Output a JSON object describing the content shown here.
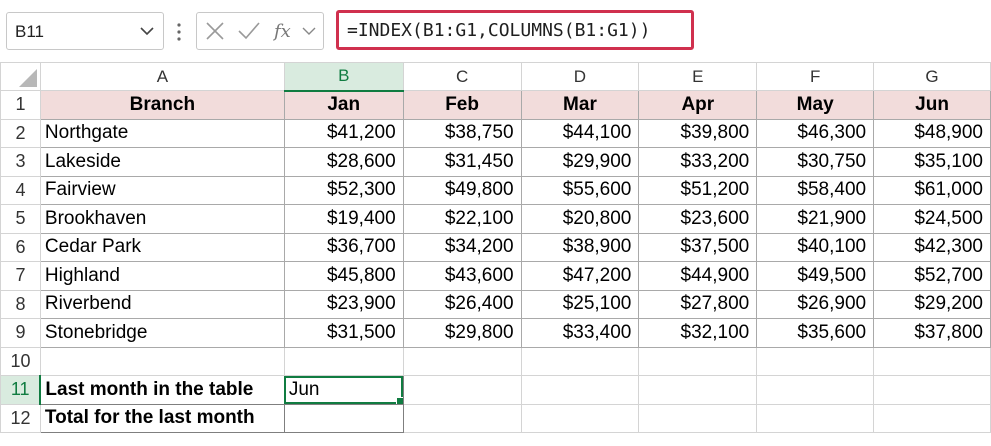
{
  "formula_bar": {
    "name_box": "B11",
    "formula": "=INDEX(B1:G1,COLUMNS(B1:G1))",
    "icons": [
      "cancel-icon",
      "enter-check-icon",
      "insert-function-icon",
      "expand-chevron-icon"
    ]
  },
  "grid": {
    "columns": [
      "A",
      "B",
      "C",
      "D",
      "E",
      "F",
      "G"
    ],
    "rows": [
      "1",
      "2",
      "3",
      "4",
      "5",
      "6",
      "7",
      "8",
      "9",
      "10",
      "11",
      "12"
    ],
    "active_cell": "B11",
    "header_row": [
      "Branch",
      "Jan",
      "Feb",
      "Mar",
      "Apr",
      "May",
      "Jun"
    ],
    "data_rows": [
      [
        "Northgate",
        "$41,200",
        "$38,750",
        "$44,100",
        "$39,800",
        "$46,300",
        "$48,900"
      ],
      [
        "Lakeside",
        "$28,600",
        "$31,450",
        "$29,900",
        "$33,200",
        "$30,750",
        "$35,100"
      ],
      [
        "Fairview",
        "$52,300",
        "$49,800",
        "$55,600",
        "$51,200",
        "$58,400",
        "$61,000"
      ],
      [
        "Brookhaven",
        "$19,400",
        "$22,100",
        "$20,800",
        "$23,600",
        "$21,900",
        "$24,500"
      ],
      [
        "Cedar Park",
        "$36,700",
        "$34,200",
        "$38,900",
        "$37,500",
        "$40,100",
        "$42,300"
      ],
      [
        "Highland",
        "$45,800",
        "$43,600",
        "$47,200",
        "$44,900",
        "$49,500",
        "$52,700"
      ],
      [
        "Riverbend",
        "$23,900",
        "$26,400",
        "$25,100",
        "$27,800",
        "$26,900",
        "$29,200"
      ],
      [
        "Stonebridge",
        "$31,500",
        "$29,800",
        "$33,400",
        "$32,100",
        "$35,600",
        "$37,800"
      ]
    ],
    "summary": [
      {
        "label": "Last month in the table",
        "value": "Jun"
      },
      {
        "label": "Total for the last month",
        "value": ""
      }
    ]
  },
  "colors": {
    "header_fill": "#f2dcdb",
    "selection_green": "#107c41",
    "formula_highlight": "#d0304e"
  }
}
